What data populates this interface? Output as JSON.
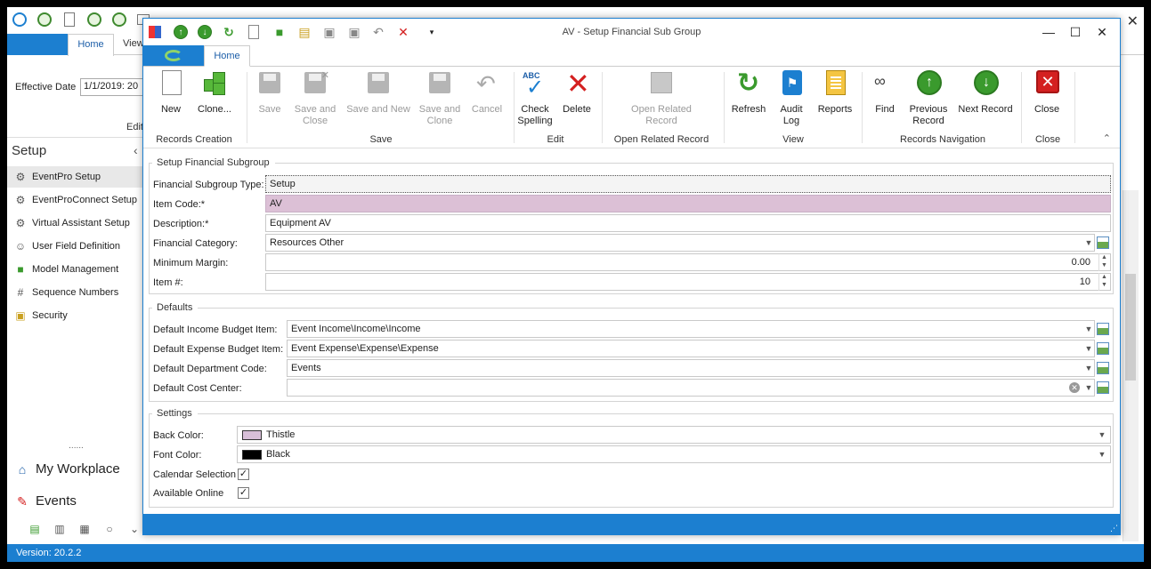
{
  "main": {
    "home_tab": "Home",
    "view_tab": "View",
    "effective_date_label": "Effective Date",
    "effective_date_value": "1/1/2019: 20",
    "edit_group_label": "Edit",
    "sidebar": {
      "title": "Setup",
      "items": [
        {
          "label": "EventPro Setup",
          "icon": "gears-icon"
        },
        {
          "label": "EventProConnect Setup",
          "icon": "gears-icon"
        },
        {
          "label": "Virtual Assistant Setup",
          "icon": "gears-icon"
        },
        {
          "label": "User Field Definition",
          "icon": "user-icon"
        },
        {
          "label": "Model Management",
          "icon": "model-icon"
        },
        {
          "label": "Sequence Numbers",
          "icon": "hash-icon"
        },
        {
          "label": "Security",
          "icon": "lock-icon"
        }
      ],
      "splitter": "......",
      "workplace": "My Workplace",
      "events": "Events"
    },
    "status": "Version: 20.2.2"
  },
  "dialog": {
    "title": "AV - Setup Financial Sub Group",
    "home_tab": "Home",
    "ribbon": {
      "groups": {
        "records_creation": "Records Creation",
        "save": "Save",
        "edit": "Edit",
        "open_related": "Open Related Record",
        "view": "View",
        "records_navigation": "Records Navigation",
        "close": "Close"
      },
      "buttons": {
        "new": "New",
        "clone": "Clone...",
        "save": "Save",
        "save_close_1": "Save and",
        "save_close_2": "Close",
        "save_new": "Save and New",
        "save_clone_1": "Save and",
        "save_clone_2": "Clone",
        "cancel": "Cancel",
        "check_1": "Check",
        "check_2": "Spelling",
        "delete": "Delete",
        "open_rel_1": "Open Related",
        "open_rel_2": "Record",
        "refresh": "Refresh",
        "audit_1": "Audit",
        "audit_2": "Log",
        "reports": "Reports",
        "find": "Find",
        "prev_1": "Previous",
        "prev_2": "Record",
        "next": "Next Record",
        "close": "Close"
      }
    },
    "form": {
      "group1_title": "Setup Financial Subgroup",
      "type_label": "Financial Subgroup Type:",
      "type_value": "Setup",
      "item_code_label": "Item Code:*",
      "item_code_value": "AV",
      "description_label": "Description:*",
      "description_value": "Equipment AV",
      "category_label": "Financial Category:",
      "category_value": "Resources Other",
      "min_margin_label": "Minimum Margin:",
      "min_margin_value": "0.00",
      "item_no_label": "Item #:",
      "item_no_value": "10",
      "group2_title": "Defaults",
      "income_label": "Default Income Budget Item:",
      "income_value": "Event Income\\Income\\Income",
      "expense_label": "Default Expense Budget Item:",
      "expense_value": "Event Expense\\Expense\\Expense",
      "dept_label": "Default Department Code:",
      "dept_value": "Events",
      "cost_label": "Default Cost Center:",
      "cost_value": "",
      "group3_title": "Settings",
      "back_color_label": "Back Color:",
      "back_color_value": "Thistle",
      "back_color_hex": "#d8bfd8",
      "font_color_label": "Font Color:",
      "font_color_value": "Black",
      "font_color_hex": "#000000",
      "calendar_label": "Calendar Selection",
      "calendar_checked": true,
      "online_label": "Available Online",
      "online_checked": true
    }
  }
}
